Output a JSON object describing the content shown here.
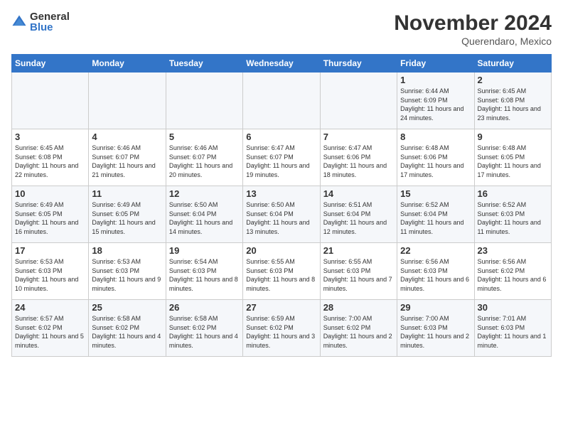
{
  "logo": {
    "general": "General",
    "blue": "Blue"
  },
  "title": "November 2024",
  "location": "Querendaro, Mexico",
  "days_of_week": [
    "Sunday",
    "Monday",
    "Tuesday",
    "Wednesday",
    "Thursday",
    "Friday",
    "Saturday"
  ],
  "weeks": [
    [
      {
        "day": "",
        "info": ""
      },
      {
        "day": "",
        "info": ""
      },
      {
        "day": "",
        "info": ""
      },
      {
        "day": "",
        "info": ""
      },
      {
        "day": "",
        "info": ""
      },
      {
        "day": "1",
        "info": "Sunrise: 6:44 AM\nSunset: 6:09 PM\nDaylight: 11 hours and 24 minutes."
      },
      {
        "day": "2",
        "info": "Sunrise: 6:45 AM\nSunset: 6:08 PM\nDaylight: 11 hours and 23 minutes."
      }
    ],
    [
      {
        "day": "3",
        "info": "Sunrise: 6:45 AM\nSunset: 6:08 PM\nDaylight: 11 hours and 22 minutes."
      },
      {
        "day": "4",
        "info": "Sunrise: 6:46 AM\nSunset: 6:07 PM\nDaylight: 11 hours and 21 minutes."
      },
      {
        "day": "5",
        "info": "Sunrise: 6:46 AM\nSunset: 6:07 PM\nDaylight: 11 hours and 20 minutes."
      },
      {
        "day": "6",
        "info": "Sunrise: 6:47 AM\nSunset: 6:07 PM\nDaylight: 11 hours and 19 minutes."
      },
      {
        "day": "7",
        "info": "Sunrise: 6:47 AM\nSunset: 6:06 PM\nDaylight: 11 hours and 18 minutes."
      },
      {
        "day": "8",
        "info": "Sunrise: 6:48 AM\nSunset: 6:06 PM\nDaylight: 11 hours and 17 minutes."
      },
      {
        "day": "9",
        "info": "Sunrise: 6:48 AM\nSunset: 6:05 PM\nDaylight: 11 hours and 17 minutes."
      }
    ],
    [
      {
        "day": "10",
        "info": "Sunrise: 6:49 AM\nSunset: 6:05 PM\nDaylight: 11 hours and 16 minutes."
      },
      {
        "day": "11",
        "info": "Sunrise: 6:49 AM\nSunset: 6:05 PM\nDaylight: 11 hours and 15 minutes."
      },
      {
        "day": "12",
        "info": "Sunrise: 6:50 AM\nSunset: 6:04 PM\nDaylight: 11 hours and 14 minutes."
      },
      {
        "day": "13",
        "info": "Sunrise: 6:50 AM\nSunset: 6:04 PM\nDaylight: 11 hours and 13 minutes."
      },
      {
        "day": "14",
        "info": "Sunrise: 6:51 AM\nSunset: 6:04 PM\nDaylight: 11 hours and 12 minutes."
      },
      {
        "day": "15",
        "info": "Sunrise: 6:52 AM\nSunset: 6:04 PM\nDaylight: 11 hours and 11 minutes."
      },
      {
        "day": "16",
        "info": "Sunrise: 6:52 AM\nSunset: 6:03 PM\nDaylight: 11 hours and 11 minutes."
      }
    ],
    [
      {
        "day": "17",
        "info": "Sunrise: 6:53 AM\nSunset: 6:03 PM\nDaylight: 11 hours and 10 minutes."
      },
      {
        "day": "18",
        "info": "Sunrise: 6:53 AM\nSunset: 6:03 PM\nDaylight: 11 hours and 9 minutes."
      },
      {
        "day": "19",
        "info": "Sunrise: 6:54 AM\nSunset: 6:03 PM\nDaylight: 11 hours and 8 minutes."
      },
      {
        "day": "20",
        "info": "Sunrise: 6:55 AM\nSunset: 6:03 PM\nDaylight: 11 hours and 8 minutes."
      },
      {
        "day": "21",
        "info": "Sunrise: 6:55 AM\nSunset: 6:03 PM\nDaylight: 11 hours and 7 minutes."
      },
      {
        "day": "22",
        "info": "Sunrise: 6:56 AM\nSunset: 6:03 PM\nDaylight: 11 hours and 6 minutes."
      },
      {
        "day": "23",
        "info": "Sunrise: 6:56 AM\nSunset: 6:02 PM\nDaylight: 11 hours and 6 minutes."
      }
    ],
    [
      {
        "day": "24",
        "info": "Sunrise: 6:57 AM\nSunset: 6:02 PM\nDaylight: 11 hours and 5 minutes."
      },
      {
        "day": "25",
        "info": "Sunrise: 6:58 AM\nSunset: 6:02 PM\nDaylight: 11 hours and 4 minutes."
      },
      {
        "day": "26",
        "info": "Sunrise: 6:58 AM\nSunset: 6:02 PM\nDaylight: 11 hours and 4 minutes."
      },
      {
        "day": "27",
        "info": "Sunrise: 6:59 AM\nSunset: 6:02 PM\nDaylight: 11 hours and 3 minutes."
      },
      {
        "day": "28",
        "info": "Sunrise: 7:00 AM\nSunset: 6:02 PM\nDaylight: 11 hours and 2 minutes."
      },
      {
        "day": "29",
        "info": "Sunrise: 7:00 AM\nSunset: 6:03 PM\nDaylight: 11 hours and 2 minutes."
      },
      {
        "day": "30",
        "info": "Sunrise: 7:01 AM\nSunset: 6:03 PM\nDaylight: 11 hours and 1 minute."
      }
    ]
  ]
}
